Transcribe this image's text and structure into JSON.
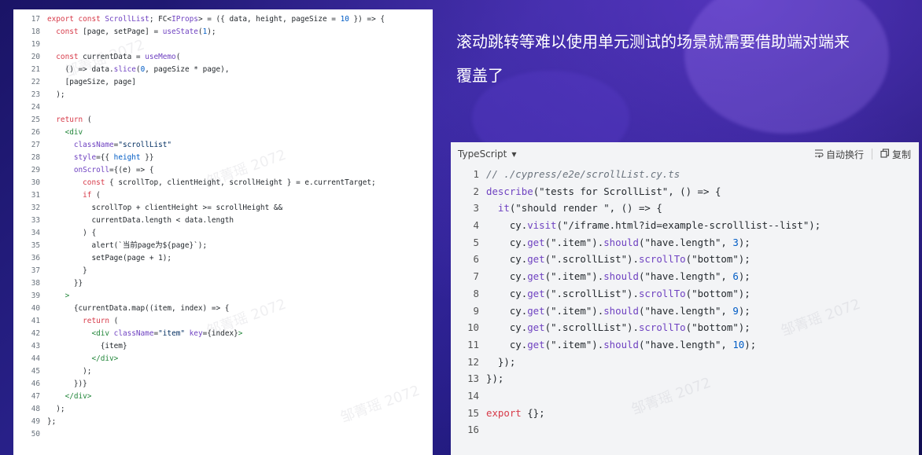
{
  "left_code": [
    {
      "n": "17",
      "tokens": [
        [
          "k",
          "export const "
        ],
        [
          "f",
          "ScrollList"
        ],
        [
          "",
          "; FC<"
        ],
        [
          "f",
          "IProps"
        ],
        [
          "",
          "> = ({ data, height, pageSize = "
        ],
        [
          "n",
          "10"
        ],
        [
          "",
          " }) => {"
        ]
      ]
    },
    {
      "n": "18",
      "tokens": [
        [
          "k",
          "  const "
        ],
        [
          "",
          "[page, setPage] = "
        ],
        [
          "f",
          "useState"
        ],
        [
          "",
          "("
        ],
        [
          "n",
          "1"
        ],
        [
          "",
          ");"
        ]
      ]
    },
    {
      "n": "19",
      "tokens": []
    },
    {
      "n": "20",
      "tokens": [
        [
          "k",
          "  const "
        ],
        [
          "",
          "currentData = "
        ],
        [
          "f",
          "useMemo"
        ],
        [
          "",
          "("
        ]
      ]
    },
    {
      "n": "21",
      "tokens": [
        [
          "",
          "    () => data."
        ],
        [
          "f",
          "slice"
        ],
        [
          "",
          "("
        ],
        [
          "n",
          "0"
        ],
        [
          "",
          ", pageSize * page),"
        ]
      ]
    },
    {
      "n": "22",
      "tokens": [
        [
          "",
          "    [pageSize, page]"
        ]
      ]
    },
    {
      "n": "23",
      "tokens": [
        [
          "",
          "  );"
        ]
      ]
    },
    {
      "n": "24",
      "tokens": []
    },
    {
      "n": "25",
      "tokens": [
        [
          "k",
          "  return "
        ],
        [
          "",
          "("
        ]
      ]
    },
    {
      "n": "26",
      "tokens": [
        [
          "t",
          "    <div"
        ]
      ]
    },
    {
      "n": "27",
      "tokens": [
        [
          "f",
          "      className"
        ],
        [
          "",
          "="
        ],
        [
          "s",
          "\"scrollList\""
        ]
      ]
    },
    {
      "n": "28",
      "tokens": [
        [
          "f",
          "      style"
        ],
        [
          "",
          "={{ "
        ],
        [
          "n",
          "height"
        ],
        [
          "",
          " }}"
        ]
      ]
    },
    {
      "n": "29",
      "tokens": [
        [
          "f",
          "      onScroll"
        ],
        [
          "",
          "={(e) => {"
        ]
      ]
    },
    {
      "n": "30",
      "tokens": [
        [
          "k",
          "        const "
        ],
        [
          "",
          "{ scrollTop, clientHeight, scrollHeight } = e.currentTarget;"
        ]
      ]
    },
    {
      "n": "31",
      "tokens": [
        [
          "k",
          "        if "
        ],
        [
          "",
          "("
        ]
      ]
    },
    {
      "n": "32",
      "tokens": [
        [
          "",
          "          scrollTop + clientHeight >= scrollHeight &&"
        ]
      ]
    },
    {
      "n": "33",
      "tokens": [
        [
          "",
          "          currentData.length < data.length"
        ]
      ]
    },
    {
      "n": "34",
      "tokens": [
        [
          "",
          "        ) {"
        ]
      ]
    },
    {
      "n": "35",
      "tokens": [
        [
          "",
          "          alert(`当前page为${page}`);"
        ]
      ]
    },
    {
      "n": "36",
      "tokens": [
        [
          "",
          "          setPage(page + 1);"
        ]
      ]
    },
    {
      "n": "37",
      "tokens": [
        [
          "",
          "        }"
        ]
      ]
    },
    {
      "n": "38",
      "tokens": [
        [
          "",
          "      }}"
        ]
      ]
    },
    {
      "n": "39",
      "tokens": [
        [
          "t",
          "    >"
        ]
      ]
    },
    {
      "n": "40",
      "tokens": [
        [
          "",
          "      {currentData.map((item, index) => {"
        ]
      ]
    },
    {
      "n": "41",
      "tokens": [
        [
          "k",
          "        return "
        ],
        [
          "",
          "("
        ]
      ]
    },
    {
      "n": "42",
      "tokens": [
        [
          "t",
          "          <div "
        ],
        [
          "f",
          "className"
        ],
        [
          "",
          "="
        ],
        [
          "s",
          "\"item\""
        ],
        [
          "f",
          " key"
        ],
        [
          "",
          "={index}"
        ],
        [
          "t",
          ">"
        ]
      ]
    },
    {
      "n": "43",
      "tokens": [
        [
          "",
          "            {item}"
        ]
      ]
    },
    {
      "n": "44",
      "tokens": [
        [
          "t",
          "          </div>"
        ]
      ]
    },
    {
      "n": "45",
      "tokens": [
        [
          "",
          "        );"
        ]
      ]
    },
    {
      "n": "46",
      "tokens": [
        [
          "",
          "      })}"
        ]
      ]
    },
    {
      "n": "47",
      "tokens": [
        [
          "t",
          "    </div>"
        ]
      ]
    },
    {
      "n": "48",
      "tokens": [
        [
          "",
          "  );"
        ]
      ]
    },
    {
      "n": "49",
      "tokens": [
        [
          "",
          "};"
        ]
      ]
    },
    {
      "n": "50",
      "tokens": []
    }
  ],
  "title": {
    "line1": "滚动跳转等难以使用单元测试的场景就需要借助端对端来",
    "line2": "覆盖了"
  },
  "code_block": {
    "language": "TypeScript",
    "wrap_label": "自动换行",
    "copy_label": "复制"
  },
  "right_code": [
    {
      "n": "1",
      "tokens": [
        [
          "c",
          "// ./cypress/e2e/scrollList.cy.ts"
        ]
      ]
    },
    {
      "n": "2",
      "tokens": [
        [
          "f",
          "describe"
        ],
        [
          "",
          "(\"tests for ScrollList\", () => {"
        ]
      ]
    },
    {
      "n": "3",
      "tokens": [
        [
          "f",
          "  it"
        ],
        [
          "",
          "(\"should render \", () => {"
        ]
      ]
    },
    {
      "n": "4",
      "tokens": [
        [
          "",
          "    cy."
        ],
        [
          "f",
          "visit"
        ],
        [
          "",
          "(\"/iframe.html?id=example-scrolllist--list\");"
        ]
      ]
    },
    {
      "n": "5",
      "tokens": [
        [
          "",
          "    cy."
        ],
        [
          "f",
          "get"
        ],
        [
          "",
          "(\".item\")."
        ],
        [
          "f",
          "should"
        ],
        [
          "",
          "(\"have.length\", "
        ],
        [
          "n",
          "3"
        ],
        [
          "",
          ");"
        ]
      ]
    },
    {
      "n": "6",
      "tokens": [
        [
          "",
          "    cy."
        ],
        [
          "f",
          "get"
        ],
        [
          "",
          "(\".scrollList\")."
        ],
        [
          "f",
          "scrollTo"
        ],
        [
          "",
          "(\"bottom\");"
        ]
      ]
    },
    {
      "n": "7",
      "tokens": [
        [
          "",
          "    cy."
        ],
        [
          "f",
          "get"
        ],
        [
          "",
          "(\".item\")."
        ],
        [
          "f",
          "should"
        ],
        [
          "",
          "(\"have.length\", "
        ],
        [
          "n",
          "6"
        ],
        [
          "",
          ");"
        ]
      ]
    },
    {
      "n": "8",
      "tokens": [
        [
          "",
          "    cy."
        ],
        [
          "f",
          "get"
        ],
        [
          "",
          "(\".scrollList\")."
        ],
        [
          "f",
          "scrollTo"
        ],
        [
          "",
          "(\"bottom\");"
        ]
      ]
    },
    {
      "n": "9",
      "tokens": [
        [
          "",
          "    cy."
        ],
        [
          "f",
          "get"
        ],
        [
          "",
          "(\".item\")."
        ],
        [
          "f",
          "should"
        ],
        [
          "",
          "(\"have.length\", "
        ],
        [
          "n",
          "9"
        ],
        [
          "",
          ");"
        ]
      ]
    },
    {
      "n": "10",
      "tokens": [
        [
          "",
          "    cy."
        ],
        [
          "f",
          "get"
        ],
        [
          "",
          "(\".scrollList\")."
        ],
        [
          "f",
          "scrollTo"
        ],
        [
          "",
          "(\"bottom\");"
        ]
      ]
    },
    {
      "n": "11",
      "tokens": [
        [
          "",
          "    cy."
        ],
        [
          "f",
          "get"
        ],
        [
          "",
          "(\".item\")."
        ],
        [
          "f",
          "should"
        ],
        [
          "",
          "(\"have.length\", "
        ],
        [
          "n",
          "10"
        ],
        [
          "",
          ");"
        ]
      ]
    },
    {
      "n": "12",
      "tokens": [
        [
          "",
          "  });"
        ]
      ]
    },
    {
      "n": "13",
      "tokens": [
        [
          "",
          "});"
        ]
      ]
    },
    {
      "n": "14",
      "tokens": []
    },
    {
      "n": "15",
      "tokens": [
        [
          "k",
          "export "
        ],
        [
          "",
          "{};"
        ]
      ]
    },
    {
      "n": "16",
      "tokens": []
    }
  ],
  "watermark": "邹菁瑶 2072",
  "icons": {
    "wrap": "wrap-text-icon",
    "copy": "copy-icon",
    "dropdown": "caret-down-icon"
  }
}
